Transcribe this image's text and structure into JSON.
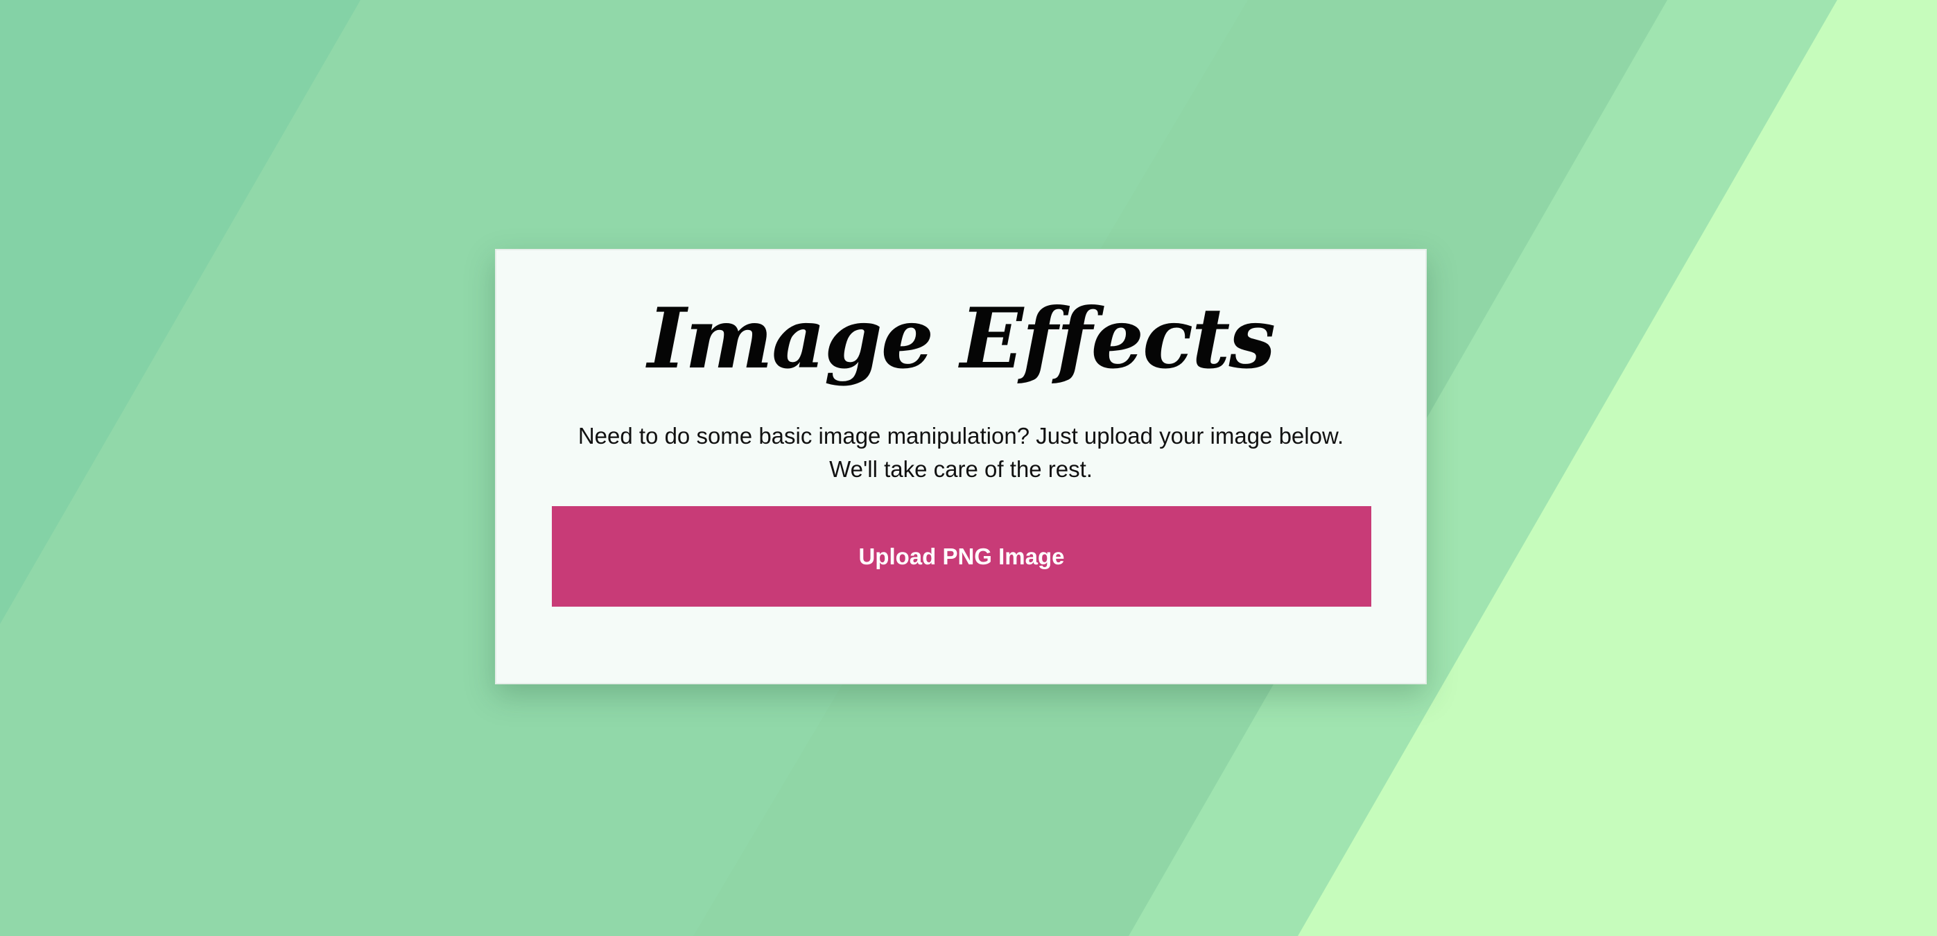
{
  "colors": {
    "background_left": "#84d2a6",
    "background_mid": "#91d8a9",
    "background_stripe": "#a0e4b0",
    "background_right": "#c6fcbc",
    "card_background": "#f5fbf8",
    "button_background": "#c83b77",
    "button_text": "#ffffff"
  },
  "card": {
    "title": "Image Effects",
    "description": "Need to do some basic image manipulation? Just upload your image below. We'll take care of the rest."
  },
  "upload": {
    "button_label": "Upload PNG Image"
  }
}
